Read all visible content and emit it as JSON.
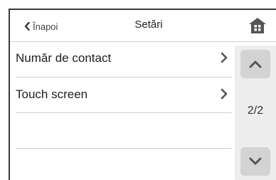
{
  "header": {
    "back_label": "Înapoi",
    "title": "Setări",
    "home_icon": "home-icon"
  },
  "list": {
    "items": [
      {
        "label": "Număr de contact",
        "icon": "chevron-right-icon"
      },
      {
        "label": "Touch screen",
        "icon": "chevron-right-icon"
      }
    ]
  },
  "pager": {
    "indicator": "2/2",
    "up_icon": "chevron-up-icon",
    "down_icon": "chevron-down-icon"
  },
  "colors": {
    "frame": "#3a3a3a",
    "divider": "#cfcfcf",
    "scroll_track": "#ededed",
    "scroll_button": "#d3d3d3",
    "icon": "#555555"
  }
}
